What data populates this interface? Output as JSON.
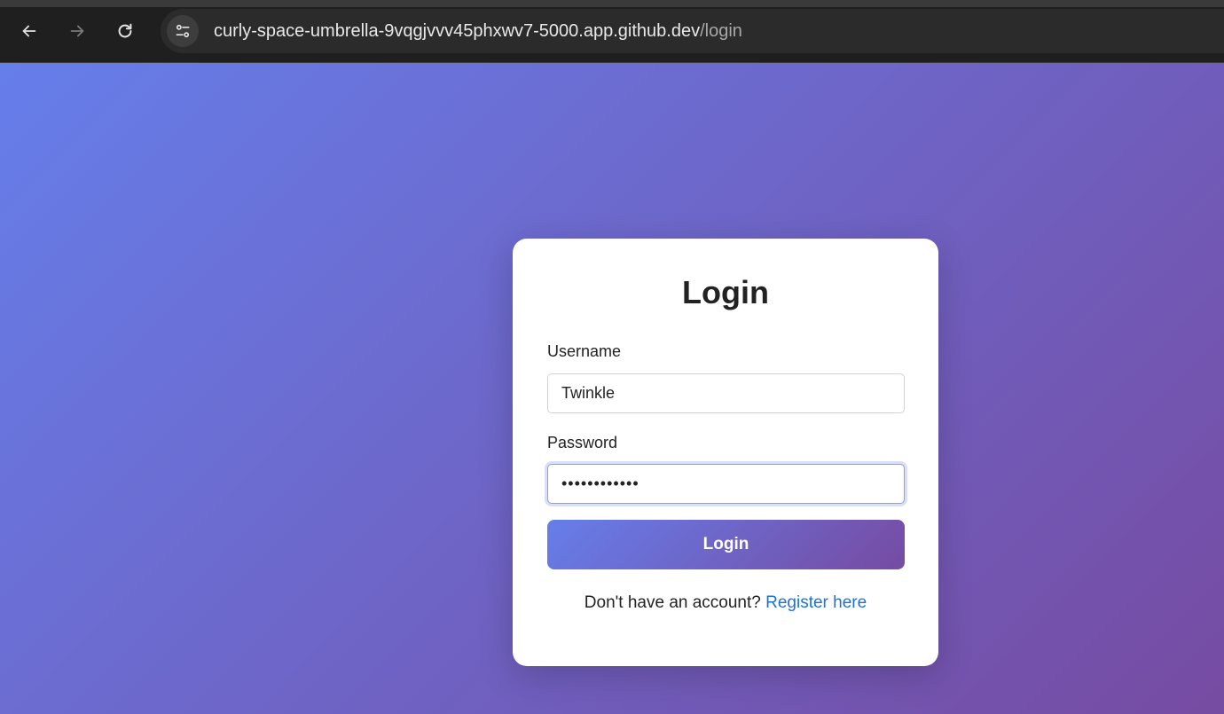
{
  "browser": {
    "url_host": "curly-space-umbrella-9vqgjvvv45phxwv7-5000.app.github.dev",
    "url_path": "/login",
    "icons": [
      "back-icon",
      "forward-icon",
      "reload-icon",
      "site-settings-icon"
    ]
  },
  "login": {
    "title": "Login",
    "username_label": "Username",
    "username_value": "Twinkle",
    "password_label": "Password",
    "password_value": "••••••••••••",
    "submit_label": "Login",
    "register_prompt": "Don't have an account?",
    "register_link": "Register here"
  },
  "colors": {
    "gradient_start": "#667eea",
    "gradient_end": "#764ba2",
    "link": "#1a73d9"
  }
}
